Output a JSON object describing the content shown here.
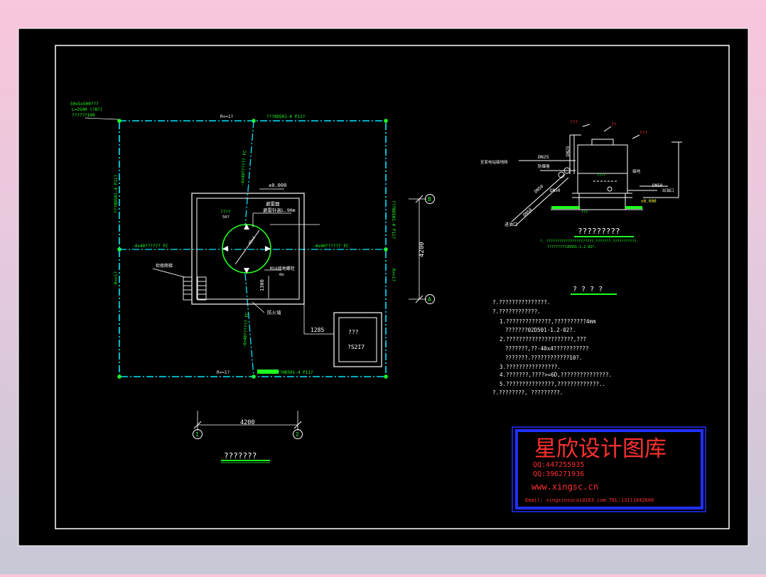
{
  "colors": {
    "background": "#000000",
    "frame": "#ffffff",
    "linework": "#ffffff",
    "annotation": "#20ff20",
    "centerline": "#00e5ff",
    "stamp_border": "#2030ff",
    "stamp_text": "#ff3030"
  },
  "plan": {
    "top_cable_label": "???0D501-4 P11?",
    "bottom_cable_label": "??0D501-4 P11?",
    "left_cable_label": "???0D501-4 P11?",
    "right_cable_label": "???0D501-4 P11?",
    "radius_top": "R<=1?",
    "radius_bottom": "R<=1?",
    "radius_left": "R<=1?",
    "radius_right": "R<=1?",
    "corner_note_1": "50x5x500???",
    "corner_note_2": "L=2500 (?8?)",
    "corner_note_3": "??????100",
    "diag_label_top": "-4x40?????? FC",
    "diag_label_bottom": "-4x40?????? FC",
    "horiz_label_left": "-4x40?????? FC",
    "horiz_label_right": "-4x40?????? FC",
    "elevation": "±0.000",
    "lightning_rod": "避雷器",
    "rod_height": "避雷针高L.90m",
    "ring_label_1": "????",
    "ring_label_2": "50?",
    "ring_inner": "-40x4",
    "bolt_label": "M16接地螺栓",
    "bolt_sub": "6m",
    "stair_label": "检修爬梯",
    "dim_1300": "1300",
    "lightning_belt": "防火墙",
    "dim_1285": "1285",
    "box_label_1": "???",
    "box_label_2": "?S2I7",
    "dim_4200_vertical": "4200",
    "dim_4200_horizontal": "4200",
    "axis_B": "B",
    "axis_A": "A",
    "axis_1": "1",
    "axis_2": "2",
    "title": "???????"
  },
  "section": {
    "label_top_1": "???",
    "label_top_2": "??",
    "label_top_3": "???",
    "pipe_dn25": "DN25",
    "pipe_dn25b": "DN25",
    "pipe_dn50a": "DN50",
    "pipe_dn50b": "DN50",
    "pipe_dn50c": "DN50",
    "pipe_label_left": "至变电站接地网",
    "pipe_label_mid": "防爆墙",
    "pipe_label_right": "接地",
    "inlet": "进油口",
    "outlet": "出油口",
    "elev": "±0.000",
    "small_1": "????",
    "small_2": "???",
    "title": "?????????",
    "note_1": "?. ??????????????????????.???????.???????????.",
    "note_2": "?????????2D501-1.2-02?."
  },
  "notes": {
    "heading": "? ? ? ?",
    "lines": [
      "?.???????????????.",
      "?.????????????.",
      "1.??????????????,??????????4mm",
      "???????02D501-1.2-02?.",
      "2.?????????????????????,???",
      "???????,??-40x4???????????",
      "???????.????????????10?.",
      "3.????????????????.",
      "4.???????,????>=6D,???????????????.",
      "5.???????????????,?????????????..",
      "?.????????, ?????????."
    ]
  },
  "stamp": {
    "title": "星欣设计图库",
    "qq1": "QQ:447255935",
    "qq2": "QQ:396271936",
    "url": "www.xingsc.cn",
    "email": "Email: xingxinsucai@163.com  TEL:13111842600"
  }
}
